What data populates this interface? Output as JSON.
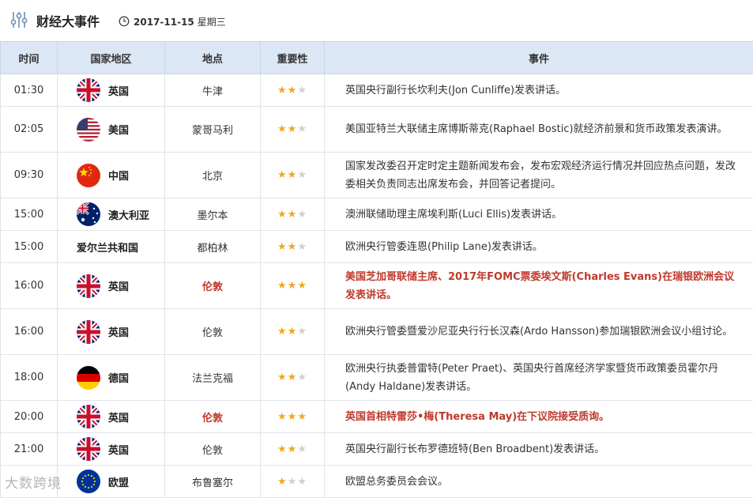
{
  "header": {
    "title": "财经大事件",
    "date": "2017-11-15",
    "weekday": "星期三"
  },
  "columns": [
    "时间",
    "国家地区",
    "地点",
    "重要性",
    "事件"
  ],
  "colors": {
    "header_bg": "#dce7f5",
    "star_on": "#f0a71e",
    "star_off": "#d0d0d0",
    "highlight": "#c0392b"
  },
  "rows": [
    {
      "time": "01:30",
      "country": "英国",
      "flag": "uk-flag-icon",
      "place": "牛津",
      "stars": "★★",
      "stars_off": "★",
      "event": "英国央行副行长坎利夫(Jon Cunliffe)发表讲话。",
      "highlight": false
    },
    {
      "time": "02:05",
      "country": "美国",
      "flag": "us-flag-icon",
      "place": "蒙哥马利",
      "stars": "★★",
      "stars_off": "★",
      "event": "美国亚特兰大联储主席博斯蒂克(Raphael Bostic)就经济前景和货币政策发表演讲。",
      "highlight": false
    },
    {
      "time": "09:30",
      "country": "中国",
      "flag": "china-flag-icon",
      "place": "北京",
      "stars": "★★",
      "stars_off": "★",
      "event": "国家发改委召开定时定主题新闻发布会，发布宏观经济运行情况并回应热点问题，发改委相关负责同志出席发布会，并回答记者提问。",
      "highlight": false
    },
    {
      "time": "15:00",
      "country": "澳大利亚",
      "flag": "australia-flag-icon",
      "place": "墨尔本",
      "stars": "★★",
      "stars_off": "★",
      "event": "澳洲联储助理主席埃利斯(Luci Ellis)发表讲话。",
      "highlight": false
    },
    {
      "time": "15:00",
      "country": "爱尔兰共和国",
      "flag": "",
      "place": "都柏林",
      "stars": "★★",
      "stars_off": "★",
      "event": "欧洲央行管委连恩(Philip Lane)发表讲话。",
      "highlight": false
    },
    {
      "time": "16:00",
      "country": "英国",
      "flag": "uk-flag-icon",
      "place": "伦敦",
      "stars": "★★★",
      "stars_off": "",
      "event": "美国芝加哥联储主席、2017年FOMC票委埃文斯(Charles Evans)在瑞银欧洲会议发表讲话。",
      "highlight": true
    },
    {
      "time": "16:00",
      "country": "英国",
      "flag": "uk-flag-icon",
      "place": "伦敦",
      "stars": "★★",
      "stars_off": "★",
      "event": "欧洲央行管委暨爱沙尼亚央行行长汉森(Ardo Hansson)参加瑞银欧洲会议小组讨论。",
      "highlight": false
    },
    {
      "time": "18:00",
      "country": "德国",
      "flag": "germany-flag-icon",
      "place": "法兰克福",
      "stars": "★★",
      "stars_off": "★",
      "event": "欧洲央行执委普雷特(Peter Praet)、英国央行首席经济学家暨货币政策委员霍尔丹(Andy Haldane)发表讲话。",
      "highlight": false
    },
    {
      "time": "20:00",
      "country": "英国",
      "flag": "uk-flag-icon",
      "place": "伦敦",
      "stars": "★★★",
      "stars_off": "",
      "event": "英国首相特雷莎•梅(Theresa May)在下议院接受质询。",
      "highlight": true
    },
    {
      "time": "21:00",
      "country": "英国",
      "flag": "uk-flag-icon",
      "place": "伦敦",
      "stars": "★★",
      "stars_off": "★",
      "event": "英国央行副行长布罗德班特(Ben Broadbent)发表讲话。",
      "highlight": false
    },
    {
      "time": "",
      "country": "欧盟",
      "flag": "eu-flag-icon",
      "place": "布鲁塞尔",
      "stars": "★",
      "stars_off": "★★",
      "event": "欧盟总务委员会会议。",
      "highlight": false
    }
  ],
  "watermark": "大数跨境"
}
